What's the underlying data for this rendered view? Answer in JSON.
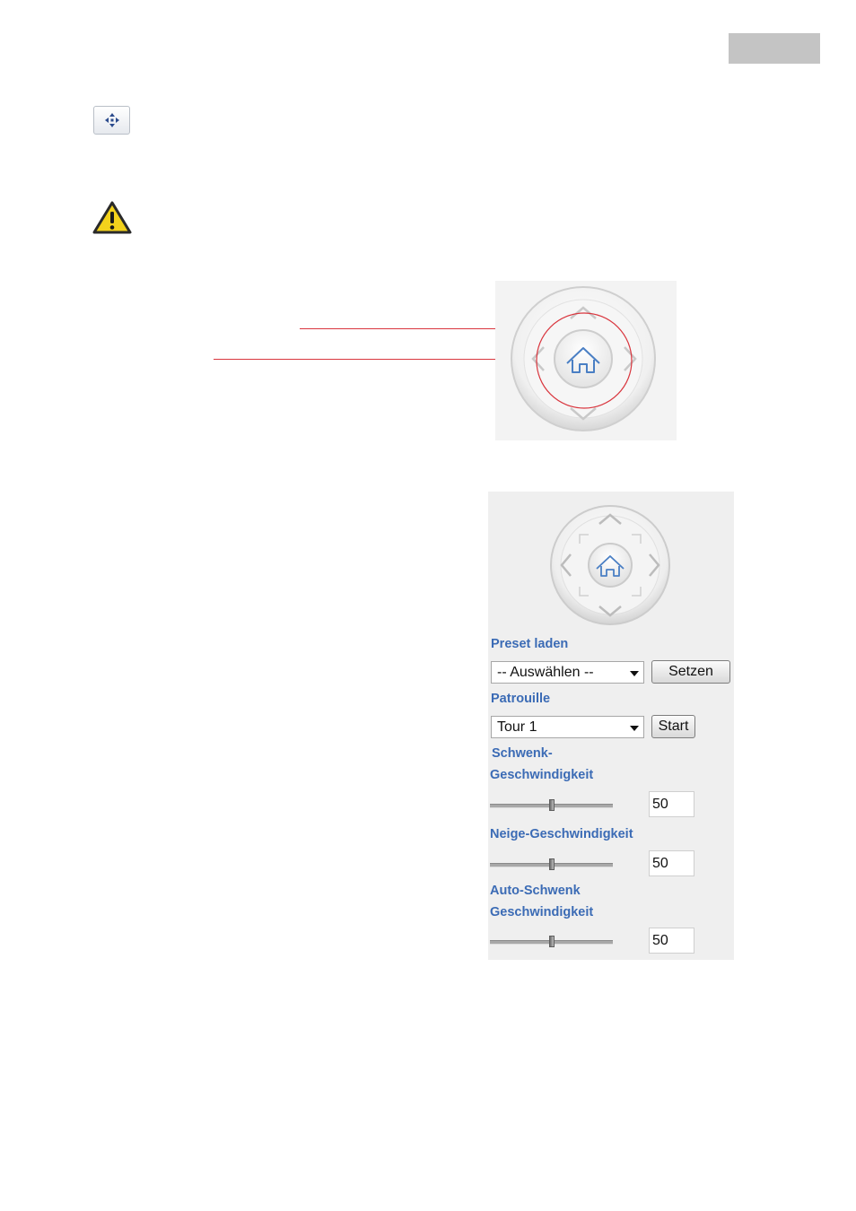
{
  "colors": {
    "accent_label": "#3b6bb5",
    "callout": "#d9363e",
    "tab": "#c4c4c4",
    "home_icon": "#4a7fc4"
  },
  "icons": {
    "ptz_button": "move-arrows-icon",
    "warning": "warning-icon",
    "home": "home-icon"
  },
  "controls": {
    "preset_label": "Preset laden",
    "preset_select_value": "-- Auswählen --",
    "preset_button": "Setzen",
    "patrol_label": "Patrouille",
    "patrol_select_value": "Tour 1",
    "patrol_button": "Start",
    "pan_speed_label_line1": "Schwenk-",
    "pan_speed_label_line2": "Geschwindigkeit",
    "pan_speed_value": "50",
    "tilt_speed_label": "Neige-Geschwindigkeit",
    "tilt_speed_value": "50",
    "auto_pan_label_line1": "Auto-Schwenk",
    "auto_pan_label_line2": "Geschwindigkeit",
    "auto_pan_value": "50"
  },
  "sliders": {
    "pan_speed_level": 0.5,
    "tilt_speed_level": 0.5,
    "auto_pan_level": 0.5
  }
}
